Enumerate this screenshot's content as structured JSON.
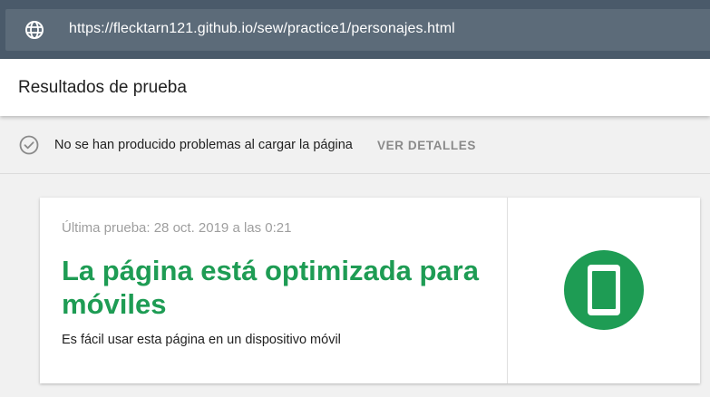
{
  "url_bar": {
    "url": "https://flecktarn121.github.io/sew/practice1/personajes.html",
    "icon": "globe-icon"
  },
  "header": {
    "title": "Resultados de prueba"
  },
  "status": {
    "icon": "check-circle-icon",
    "message": "No se han producido problemas al cargar la página",
    "details_link": "VER DETALLES"
  },
  "result_card": {
    "last_test": "Última prueba: 28 oct. 2019 a las 0:21",
    "title": "La página está optimizada para móviles",
    "description": "Es fácil usar esta página en un dispositivo móvil",
    "badge_icon": "mobile-phone-icon",
    "accent_color": "#1e9c54"
  }
}
